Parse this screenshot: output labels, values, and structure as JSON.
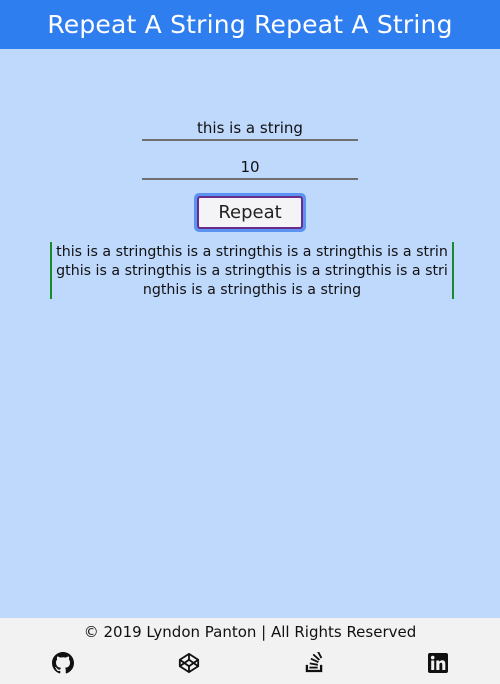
{
  "header": {
    "title": "Repeat A String Repeat A String"
  },
  "form": {
    "string_value": "this is a string",
    "count_value": "10",
    "repeat_label": "Repeat"
  },
  "output": {
    "text": "this is a stringthis is a stringthis is a stringthis is a stringthis is a stringthis is a stringthis is a stringthis is a stringthis is a stringthis is a string"
  },
  "footer": {
    "copyright": "© 2019 Lyndon Panton | All Rights Reserved",
    "links": [
      {
        "icon": "github-icon"
      },
      {
        "icon": "codepen-icon"
      },
      {
        "icon": "stackoverflow-icon"
      },
      {
        "icon": "linkedin-icon"
      }
    ]
  },
  "colors": {
    "header_bg": "#2f7ef0",
    "page_bg": "#bfd9fd",
    "footer_bg": "#f2f2f2",
    "output_border": "#1a8a2b",
    "button_focus_ring": "#5a93f2",
    "button_border": "#6a2d8c"
  }
}
